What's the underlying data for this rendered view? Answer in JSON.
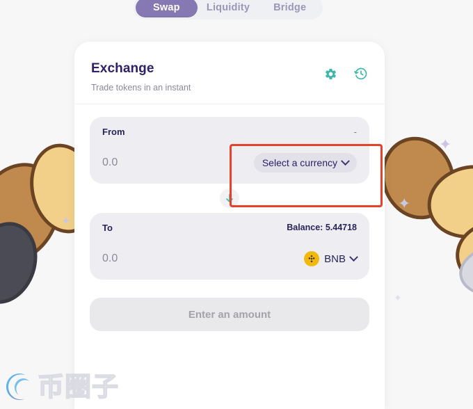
{
  "tabs": [
    {
      "label": "Swap",
      "active": true
    },
    {
      "label": "Liquidity",
      "active": false
    },
    {
      "label": "Bridge",
      "active": false
    }
  ],
  "header": {
    "title": "Exchange",
    "subtitle": "Trade tokens in an instant",
    "settings_icon": "gear-icon",
    "history_icon": "history-icon"
  },
  "from_panel": {
    "label": "From",
    "right_note": "-",
    "amount": "0.0",
    "currency_label": "Select a currency",
    "chevron_icon": "chevron-down-icon"
  },
  "swap_arrow": {
    "icon": "arrow-down-icon"
  },
  "to_panel": {
    "label": "To",
    "balance": "Balance: 5.44718",
    "amount": "0.0",
    "currency_label": "BNB",
    "token_icon": "bnb-icon",
    "chevron_icon": "chevron-down-icon"
  },
  "action_button": {
    "label": "Enter an amount",
    "enabled": false
  },
  "annotation": {
    "shape": "rectangle",
    "color": "#e8412a"
  },
  "watermark": {
    "text": "币圈子",
    "logo_icon": "swirl-logo-icon"
  },
  "colors": {
    "accent_purple": "#8678b3",
    "title_navy": "#2e2069",
    "teal_icon": "#3fb6ad",
    "panel_bg": "#eeeef2",
    "bnb_yellow": "#f0b90b",
    "annotation_red": "#e8412a",
    "page_bg": "#f7f7f8"
  }
}
